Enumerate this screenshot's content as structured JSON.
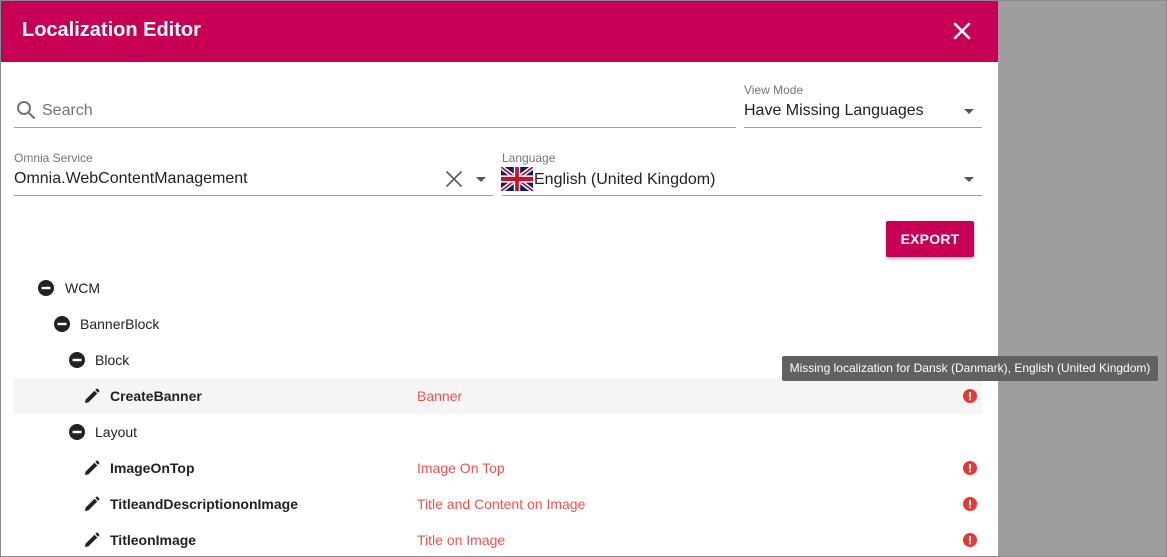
{
  "dialog": {
    "title": "Localization Editor",
    "close_icon": "close-icon"
  },
  "search": {
    "placeholder": "Search",
    "value": "",
    "icon": "search-icon"
  },
  "view_mode": {
    "label": "View Mode",
    "value": "Have Missing Languages"
  },
  "omnia_service": {
    "label": "Omnia Service",
    "value": "Omnia.WebContentManagement"
  },
  "language": {
    "label": "Language",
    "value": "English (United Kingdom)",
    "flag_icon": "uk-flag-icon"
  },
  "export_button": "EXPORT",
  "tree": [
    {
      "label": "WCM",
      "type": "group",
      "value": "",
      "missing": false
    },
    {
      "label": "BannerBlock",
      "type": "group",
      "value": "",
      "missing": false
    },
    {
      "label": "Block",
      "type": "group",
      "value": "",
      "missing": false
    },
    {
      "label": "CreateBanner",
      "type": "item",
      "value": "Banner",
      "missing": true,
      "selected": true
    },
    {
      "label": "Layout",
      "type": "group",
      "value": "",
      "missing": false
    },
    {
      "label": "ImageOnTop",
      "type": "item",
      "value": "Image On Top",
      "missing": true
    },
    {
      "label": "TitleandDescriptiononImage",
      "type": "item",
      "value": "Title and Content on Image",
      "missing": true
    },
    {
      "label": "TitleonImage",
      "type": "item",
      "value": "Title on Image",
      "missing": true
    }
  ],
  "tooltip": "Missing localization for Dansk (Danmark), English (United Kingdom)",
  "colors": {
    "accent": "#c70055",
    "value_text": "#ef5350",
    "warning": "#e53935",
    "overlay": "#9e9e9e"
  }
}
